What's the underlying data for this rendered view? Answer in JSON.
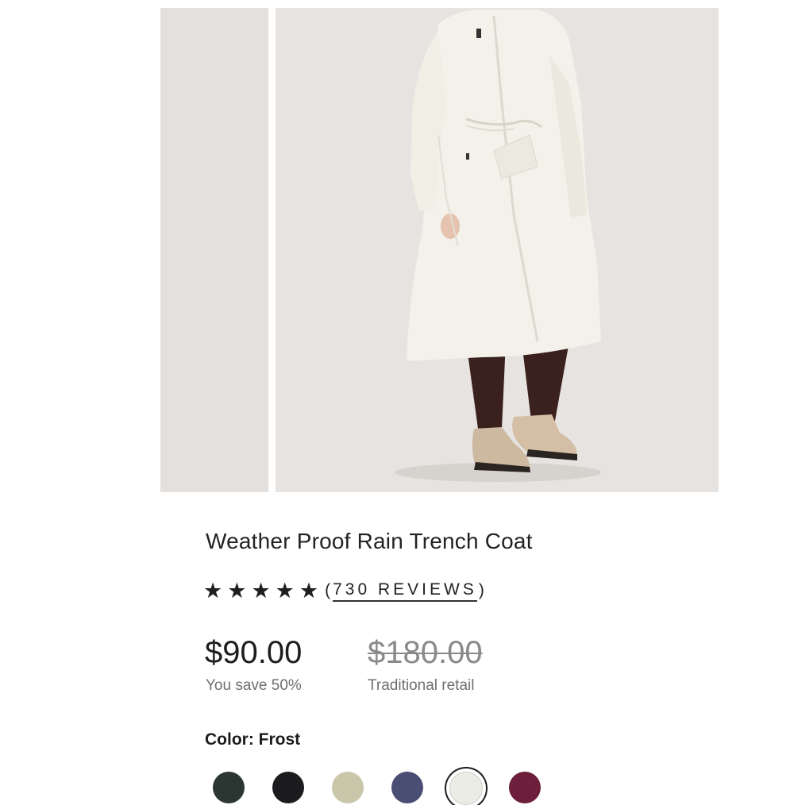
{
  "product": {
    "title": "Weather Proof Rain Trench Coat",
    "rating": {
      "stars_filled": 5,
      "stars_total": 5,
      "paren_open": "(",
      "reviews_text": "730 REVIEWS",
      "paren_close": ")"
    },
    "price": "$90.00",
    "savings": "You save 50%",
    "original_price": "$180.00",
    "original_label": "Traditional retail",
    "color_label": "Color: Frost",
    "swatches": [
      {
        "color": "#2b3633",
        "selected": false
      },
      {
        "color": "#1c1c1f",
        "selected": false
      },
      {
        "color": "#c9c6aa",
        "selected": false
      },
      {
        "color": "#4a4d74",
        "selected": false
      },
      {
        "color": "#ecece6",
        "selected": true
      },
      {
        "color": "#6d1e3a",
        "selected": false
      }
    ]
  },
  "icons": {
    "star": "star-icon"
  }
}
